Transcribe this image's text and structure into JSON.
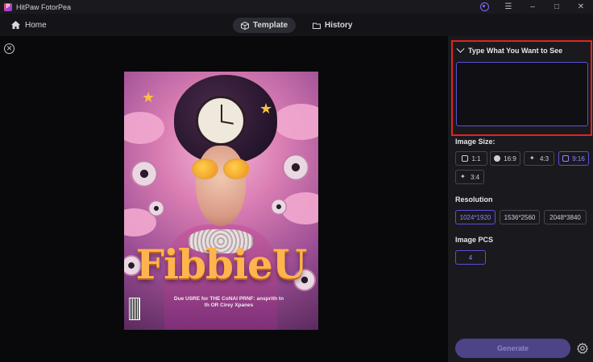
{
  "app": {
    "name": "HitPaw FotorPea"
  },
  "nav": {
    "home_label": "Home",
    "tabs": [
      {
        "label": "Template",
        "active": true
      },
      {
        "label": "History",
        "active": false
      }
    ]
  },
  "poster": {
    "title": "FibbieU",
    "subtitle": "Due USRE for THE CoNAI PRNF: ansprith tn th OR Cirey Xpanes"
  },
  "panel": {
    "prompt": {
      "header": "Type What You Want to See",
      "value": "",
      "placeholder": ""
    },
    "image_size": {
      "label": "Image Size:",
      "options": [
        "1:1",
        "16:9",
        "4:3",
        "9:16",
        "3:4"
      ],
      "selected": "9:16"
    },
    "resolution": {
      "label": "Resolution",
      "options": [
        "1024*1920",
        "1536*2560",
        "2048*3840"
      ],
      "selected": "1024*1920"
    },
    "image_pcs": {
      "label": "Image PCS",
      "value": "4"
    },
    "generate_label": "Generate"
  },
  "colors": {
    "accent": "#5a4fd8",
    "highlight_border": "#e02424",
    "generate_bg": "#4d4387"
  }
}
